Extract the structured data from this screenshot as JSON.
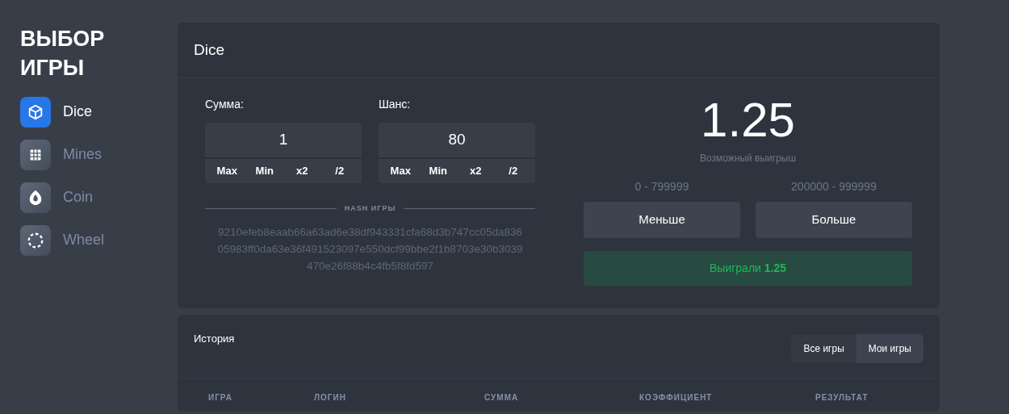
{
  "sidebar": {
    "title": "ВЫБОР ИГРЫ",
    "items": [
      {
        "label": "Dice",
        "selected": true
      },
      {
        "label": "Mines",
        "selected": false
      },
      {
        "label": "Coin",
        "selected": false
      },
      {
        "label": "Wheel",
        "selected": false
      }
    ]
  },
  "game": {
    "title": "Dice",
    "inputs": [
      {
        "label": "Сумма:",
        "value": "1",
        "actions": [
          "Max",
          "Min",
          "x2",
          "/2"
        ]
      },
      {
        "label": "Шанс:",
        "value": "80",
        "actions": [
          "Max",
          "Min",
          "x2",
          "/2"
        ]
      }
    ],
    "hash_label": "HASH ИГРЫ",
    "hash": "9210efeb8eaab66a63ad6e38df943331cfa68d3b747cc05da83605983ff0da63e36f491523097e550dcf99bbe2f1b8703e30b3039470e26f88b4c4fb5f8fd597",
    "payout": "1.25",
    "payout_caption": "Возможный выигрыш",
    "bets": [
      {
        "range": "0 - 799999",
        "label": "Меньше"
      },
      {
        "range": "200000 - 999999",
        "label": "Больше"
      }
    ],
    "result": "Выиграли **1.25**"
  },
  "history": {
    "title": "История",
    "filters": [
      {
        "label": "Все игры",
        "selected": false
      },
      {
        "label": "Мои игры",
        "selected": true
      }
    ],
    "columns": [
      "ИГРА",
      "ЛОГИН",
      "СУММА",
      "КОЭФФИЦИЕНТ",
      "РЕЗУЛЬТАТ"
    ]
  }
}
